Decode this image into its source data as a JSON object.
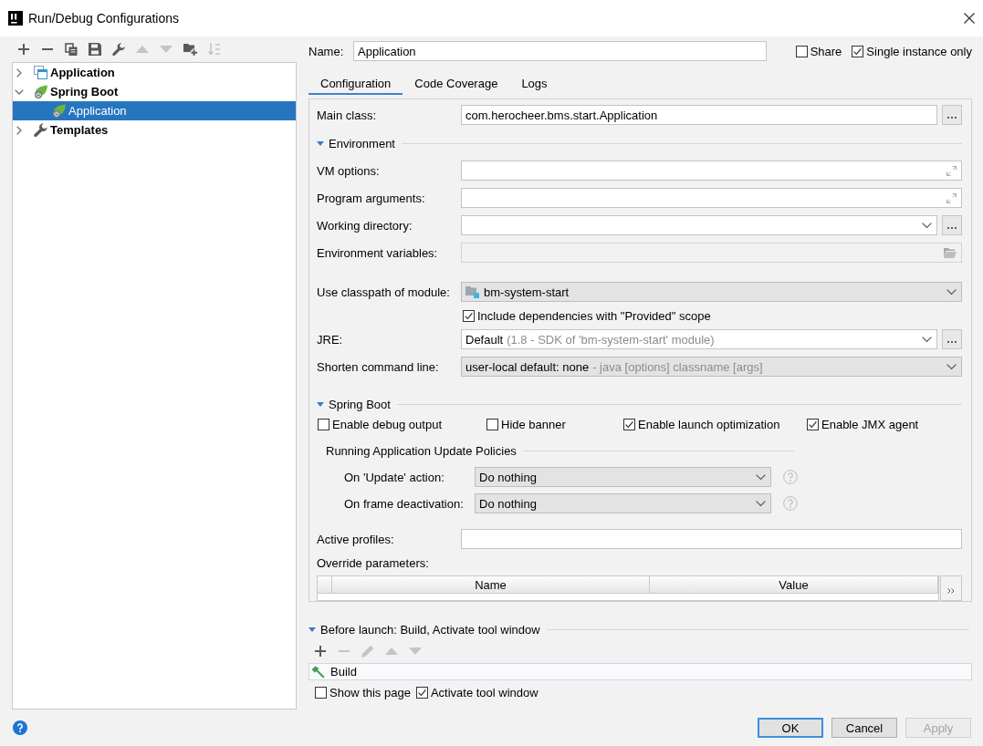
{
  "window": {
    "title": "Run/Debug Configurations"
  },
  "sidebar": {
    "toolbar": [
      {
        "kind": "add",
        "disabled": false
      },
      {
        "kind": "remove",
        "disabled": false
      },
      {
        "kind": "copy",
        "disabled": false
      },
      {
        "kind": "save",
        "disabled": false
      },
      {
        "kind": "settings",
        "disabled": false
      },
      {
        "kind": "move-up",
        "disabled": true
      },
      {
        "kind": "move-down",
        "disabled": true
      },
      {
        "kind": "new-folder",
        "disabled": false
      },
      {
        "kind": "sort",
        "disabled": true
      }
    ],
    "tree": [
      {
        "label": "Application",
        "kind": "application",
        "expanded": false,
        "selected": false
      },
      {
        "label": "Spring Boot",
        "kind": "spring-boot",
        "expanded": true,
        "selected": false,
        "children": [
          {
            "label": "Application",
            "kind": "spring-boot",
            "selected": true
          }
        ]
      },
      {
        "label": "Templates",
        "kind": "templates",
        "expanded": false,
        "selected": false
      }
    ]
  },
  "name": {
    "label": "Name:",
    "value": "Application"
  },
  "options": [
    {
      "label": "Share",
      "checked": false
    },
    {
      "label": "Single instance only",
      "checked": true
    }
  ],
  "tabs": [
    {
      "label": "Configuration",
      "selected": true
    },
    {
      "label": "Code Coverage",
      "selected": false
    },
    {
      "label": "Logs",
      "selected": false
    }
  ],
  "configuration": {
    "main_class": {
      "label": "Main class:",
      "kind": "text",
      "value": "com.herocheer.bms.start.Application",
      "browse": true
    },
    "environment": {
      "title": "Environment",
      "expanded": true,
      "fields": [
        {
          "label": "VM options:",
          "kind": "expand",
          "browse": false
        },
        {
          "label": "Program arguments:",
          "kind": "expand",
          "browse": false
        },
        {
          "label": "Working directory:",
          "kind": "combo",
          "browse": true
        },
        {
          "label": "Environment variables:",
          "kind": "disabled",
          "browse": false
        }
      ]
    },
    "module": {
      "label": "Use classpath of module:",
      "kind": "module-select",
      "value": "bm-system-start",
      "browse": false
    },
    "include_provided": {
      "label": "Include dependencies with \"Provided\" scope",
      "checked": true
    },
    "jre": {
      "label": "JRE:",
      "kind": "combo",
      "value": "Default",
      "hint": "(1.8 - SDK of 'bm-system-start' module)",
      "browse": true
    },
    "shorten_command_line": {
      "label": "Shorten command line:",
      "kind": "select",
      "value": "user-local default: none",
      "hint": "- java [options] classname [args]",
      "browse": false
    },
    "spring_boot": {
      "title": "Spring Boot",
      "expanded": true,
      "options": [
        {
          "label": "Enable debug output",
          "checked": false
        },
        {
          "label": "Hide banner",
          "checked": false
        },
        {
          "label": "Enable launch optimization",
          "checked": true
        },
        {
          "label": "Enable JMX agent",
          "checked": true
        }
      ],
      "policies": {
        "title": "Running Application Update Policies",
        "rows": [
          {
            "label": "On 'Update' action:",
            "value": "Do nothing"
          },
          {
            "label": "On frame deactivation:",
            "value": "Do nothing"
          }
        ]
      }
    },
    "active_profiles": {
      "label": "Active profiles:",
      "kind": "text",
      "browse": false
    },
    "override_parameters": {
      "label": "Override parameters:",
      "columns": [
        "Name",
        "Value"
      ]
    }
  },
  "before_launch": {
    "title": "Before launch: Build, Activate tool window",
    "expanded": true,
    "toolbar": [
      {
        "kind": "add",
        "disabled": false
      },
      {
        "kind": "remove",
        "disabled": true
      },
      {
        "kind": "edit",
        "disabled": true
      },
      {
        "kind": "move-up",
        "disabled": true
      },
      {
        "kind": "move-down",
        "disabled": true
      }
    ],
    "tasks": [
      {
        "label": "Build",
        "kind": "build"
      }
    ],
    "options": [
      {
        "label": "Show this page",
        "checked": false
      },
      {
        "label": "Activate tool window",
        "checked": true
      }
    ]
  },
  "buttons": [
    {
      "label": "OK",
      "default": true,
      "disabled": false
    },
    {
      "label": "Cancel",
      "default": false,
      "disabled": false
    },
    {
      "label": "Apply",
      "default": false,
      "disabled": true
    }
  ]
}
